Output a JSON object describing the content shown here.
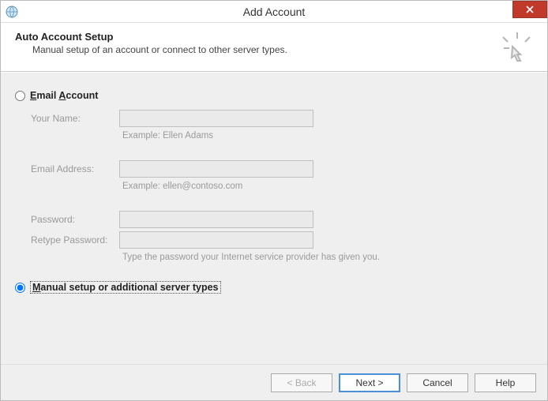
{
  "window": {
    "title": "Add Account"
  },
  "header": {
    "title": "Auto Account Setup",
    "subtitle": "Manual setup of an account or connect to other server types."
  },
  "options": {
    "email_account": {
      "label": "Email Account",
      "selected": false
    },
    "manual": {
      "label": "Manual setup or additional server types",
      "selected": true
    }
  },
  "fields": {
    "your_name": {
      "label": "Your Name:",
      "value": "",
      "example": "Example: Ellen Adams"
    },
    "email": {
      "label": "Email Address:",
      "value": "",
      "example": "Example: ellen@contoso.com"
    },
    "password": {
      "label": "Password:",
      "value": ""
    },
    "retype": {
      "label": "Retype Password:",
      "value": "",
      "hint": "Type the password your Internet service provider has given you."
    }
  },
  "buttons": {
    "back": "< Back",
    "next": "Next >",
    "cancel": "Cancel",
    "help": "Help"
  }
}
